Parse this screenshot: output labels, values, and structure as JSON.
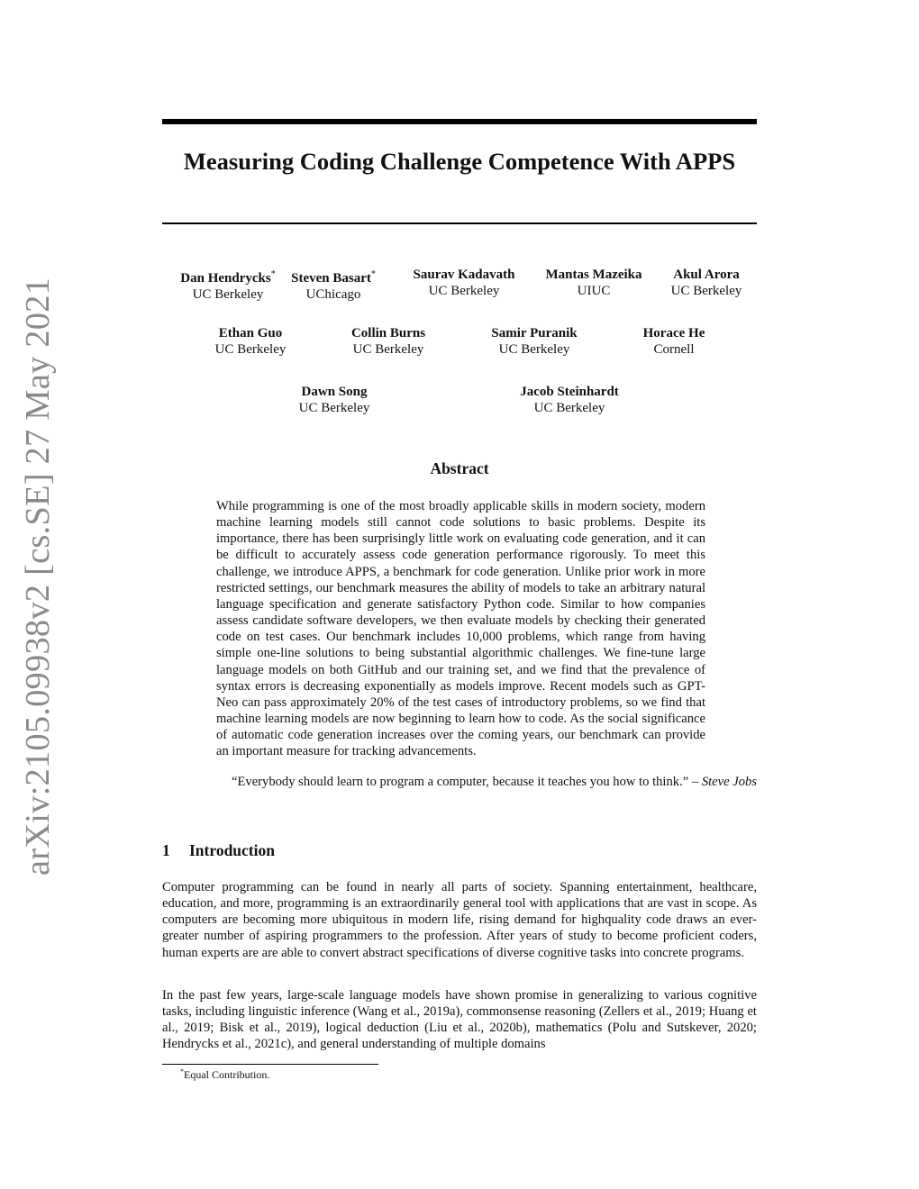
{
  "arxiv_stamp": "arXiv:2105.09938v2  [cs.SE]  27 May 2021",
  "title": "Measuring Coding Challenge Competence With APPS",
  "authors": [
    {
      "name": "Dan Hendrycks",
      "mark": "*",
      "affiliation": "UC Berkeley"
    },
    {
      "name": "Steven Basart",
      "mark": "*",
      "affiliation": "UChicago"
    },
    {
      "name": "Saurav Kadavath",
      "mark": "",
      "affiliation": "UC Berkeley"
    },
    {
      "name": "Mantas Mazeika",
      "mark": "",
      "affiliation": "UIUC"
    },
    {
      "name": "Akul Arora",
      "mark": "",
      "affiliation": "UC Berkeley"
    },
    {
      "name": "Ethan Guo",
      "mark": "",
      "affiliation": "UC Berkeley"
    },
    {
      "name": "Collin Burns",
      "mark": "",
      "affiliation": "UC Berkeley"
    },
    {
      "name": "Samir Puranik",
      "mark": "",
      "affiliation": "UC Berkeley"
    },
    {
      "name": "Horace He",
      "mark": "",
      "affiliation": "Cornell"
    },
    {
      "name": "Dawn Song",
      "mark": "",
      "affiliation": "UC Berkeley"
    },
    {
      "name": "Jacob Steinhardt",
      "mark": "",
      "affiliation": "UC Berkeley"
    }
  ],
  "abstract": {
    "heading": "Abstract",
    "text": "While programming is one of the most broadly applicable skills in modern society, modern machine learning models still cannot code solutions to basic problems. Despite its importance, there has been surprisingly little work on evaluating code generation, and it can be difficult to accurately assess code generation performance rigorously. To meet this challenge, we introduce APPS, a benchmark for code gen­eration. Unlike prior work in more restricted settings, our benchmark measures the ability of models to take an arbitrary natural language specification and generate sat­isfactory Python code. Similar to how companies assess candidate software devel­opers, we then evaluate models by checking their generated code on test cases. Our benchmark includes 10,000 problems, which range from having simple one-line solutions to being substantial algorithmic challenges. We fine-tune large language models on both GitHub and our training set, and we find that the prevalence of syntax errors is decreasing exponentially as models improve. Recent models such as GPT-Neo can pass approximately 20% of the test cases of introductory problems, so we find that machine learning models are now beginning to learn how to code. As the social significance of automatic code generation increases over the coming years, our benchmark can provide an important measure for tracking advancements."
  },
  "quote": {
    "text": "“Everybody should learn to program a computer, because it teaches you how to think.” – ",
    "attribution": "Steve Jobs"
  },
  "section": {
    "number": "1",
    "title": "Introduction",
    "paragraphs": [
      "Computer programming can be found in nearly all parts of society. Spanning entertainment, health­care, education, and more, programming is an extraordinarily general tool with applications that are vast in scope. As computers are becoming more ubiquitous in modern life, rising demand for high­quality code draws an ever-greater number of aspiring programmers to the profession. After years of study to become proficient coders, human experts are are able to convert abstract specifications of diverse cognitive tasks into concrete programs.",
      "In the past few years, large-scale language models have shown promise in generalizing to various cognitive tasks, including linguistic inference (Wang et al., 2019a), commonsense reasoning (Zellers et al., 2019; Huang et al., 2019; Bisk et al., 2019), logical deduction (Liu et al., 2020b), mathematics (Polu and Sutskever, 2020; Hendrycks et al., 2021c), and general understanding of multiple domains"
    ]
  },
  "footnote": {
    "mark": "*",
    "text": "Equal Contribution."
  }
}
